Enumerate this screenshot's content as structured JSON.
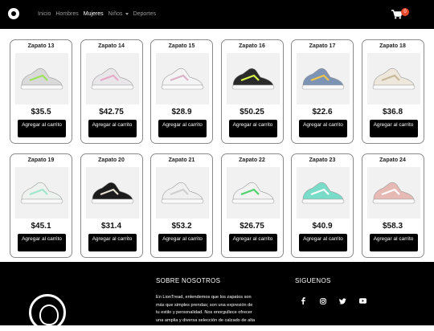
{
  "nav": {
    "links": [
      {
        "label": "Inicio",
        "active": false
      },
      {
        "label": "Hombres",
        "active": false
      },
      {
        "label": "Mujeres",
        "active": true
      },
      {
        "label": "Niños",
        "active": false,
        "dropdown": true
      },
      {
        "label": "Deportes",
        "active": false
      }
    ],
    "cart_count": "0"
  },
  "button_label": "Agregar al carrito",
  "products": [
    {
      "name": "Zapato 13",
      "price": "$35.5",
      "shoe_color": "#d9d9d9",
      "accent": "#9be35a"
    },
    {
      "name": "Zapato 14",
      "price": "$42.75",
      "shoe_color": "#e9e6ea",
      "accent": "#e7a8c8"
    },
    {
      "name": "Zapato 15",
      "price": "$28.9",
      "shoe_color": "#f4f4f4",
      "accent": "#d9b2c8"
    },
    {
      "name": "Zapato 16",
      "price": "$50.25",
      "shoe_color": "#2a2a2a",
      "accent": "#d8f24a"
    },
    {
      "name": "Zapato 17",
      "price": "$22.6",
      "shoe_color": "#7d93b4",
      "accent": "#f1c64a"
    },
    {
      "name": "Zapato 18",
      "price": "$36.8",
      "shoe_color": "#eee7dc",
      "accent": "#c8b89a"
    },
    {
      "name": "Zapato 19",
      "price": "$45.1",
      "shoe_color": "#eef2ee",
      "accent": "#9ee6cf"
    },
    {
      "name": "Zapato 20",
      "price": "$31.4",
      "shoe_color": "#1c1c1c",
      "accent": "#e6e1d2"
    },
    {
      "name": "Zapato 21",
      "price": "$53.2",
      "shoe_color": "#f0f0f0",
      "accent": "#cfcfcf"
    },
    {
      "name": "Zapato 22",
      "price": "$26.75",
      "shoe_color": "#f2f2f2",
      "accent": "#4fd16a"
    },
    {
      "name": "Zapato 23",
      "price": "$40.9",
      "shoe_color": "#79dcc9",
      "accent": "#ffffff"
    },
    {
      "name": "Zapato 24",
      "price": "$58.3",
      "shoe_color": "#e6b9b4",
      "accent": "#ffffff"
    }
  ],
  "footer": {
    "about_title": "SOBRE NOSOTROS",
    "about_lines": [
      "En LionTread, entendemos que los zapatos son",
      "más que simples prendas; son una expresión de",
      "tu estilo y personalidad. Nos enorgullece ofrecer",
      "una amplia y diversa selección de calzado de alta"
    ],
    "follow_title": "SIGUENOS",
    "social": [
      "facebook-icon",
      "instagram-icon",
      "twitter-icon",
      "youtube-icon"
    ]
  }
}
